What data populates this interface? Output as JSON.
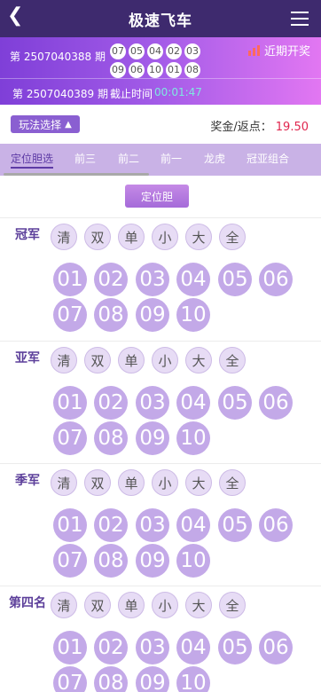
{
  "header": {
    "back_icon": "back-arrow-icon",
    "title": "极速飞车",
    "menu_icon": "hamburger-menu-icon"
  },
  "draw": {
    "current_period": "第 2507040388 期",
    "balls_row1": [
      "07",
      "05",
      "04",
      "02",
      "03"
    ],
    "balls_row2": [
      "09",
      "06",
      "10",
      "01",
      "08"
    ],
    "recent_label": "近期开奖",
    "recent_icon": "bar-chart-icon",
    "next_period": "第 2507040389 期",
    "deadline_label": "截止时间",
    "deadline_time": "00:01:47"
  },
  "play": {
    "select_label": "玩法选择",
    "chevron_icon": "chevron-up-icon",
    "prize_label": "奖金/返点：",
    "prize_value": "19.50"
  },
  "tabs": [
    {
      "label": "定位胆选",
      "active": true
    },
    {
      "label": "前三",
      "active": false
    },
    {
      "label": "前二",
      "active": false
    },
    {
      "label": "前一",
      "active": false
    },
    {
      "label": "龙虎",
      "active": false
    },
    {
      "label": "冠亚组合",
      "active": false
    }
  ],
  "mode_button": "定位胆",
  "quick_buttons": [
    "清",
    "双",
    "单",
    "小",
    "大",
    "全"
  ],
  "numbers": [
    "01",
    "02",
    "03",
    "04",
    "05",
    "06",
    "07",
    "08",
    "09",
    "10"
  ],
  "positions": [
    "冠军",
    "亚军",
    "季军",
    "第四名"
  ],
  "colors": {
    "header_bg": "#3e2a6e",
    "banner_start": "#7f3fd8",
    "banner_end": "#e277f2",
    "tab_bg": "#c9b2e6",
    "number_ball": "#c3a9e8",
    "prize_value": "#e0264e",
    "deadline_time": "#7ee8e0"
  }
}
